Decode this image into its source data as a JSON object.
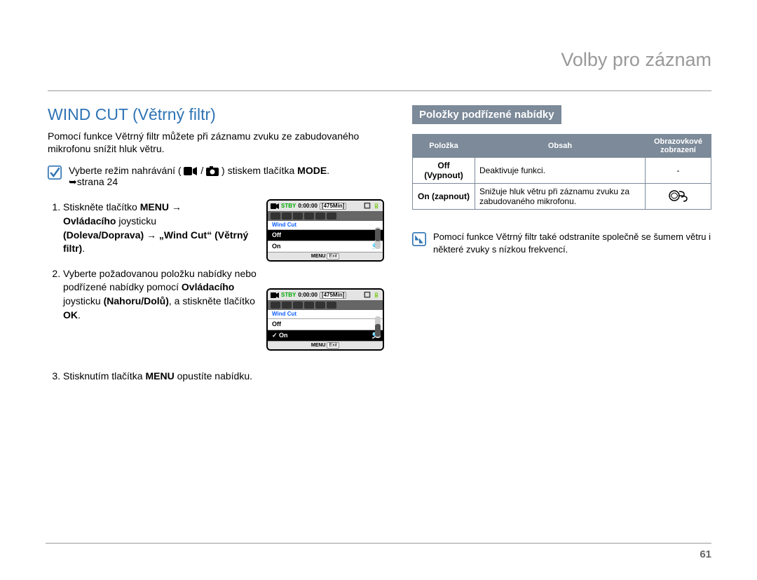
{
  "header": {
    "section": "Volby pro záznam"
  },
  "left": {
    "heading": "WIND CUT (Větrný filtr)",
    "intro": "Pomocí funkce Větrný filtr můžete při záznamu zvuku ze zabudovaného mikrofonu snížit hluk větru.",
    "modeLine": {
      "before": "Vyberte režim nahrávání (",
      "after": ") stiskem tlačítka ",
      "mode": "MODE",
      "page": "➥strana 24"
    },
    "step1": {
      "a": "Stiskněte tlačítko ",
      "menu": "MENU",
      "arrow": " → ",
      "b": "Ovládacího",
      "c": " joysticku ",
      "d": "(Doleva/Doprava) → „Wind Cut“ (Větrný filtr)"
    },
    "step2": {
      "a": "Vyberte požadovanou položku nabídky nebo podřízené nabídky pomocí ",
      "b": "Ovládacího",
      "c": " joysticku ",
      "d": "(Nahoru/Dolů)",
      "e": ", a stiskněte tlačítko ",
      "f": "OK"
    },
    "step3": {
      "a": "Stisknutím tlačítka ",
      "menu": "MENU",
      "b": " opustíte nabídku."
    },
    "thumb": {
      "stby": "STBY",
      "time": "0:00:00",
      "mins": "[475Min]",
      "label": "Wind Cut",
      "off": "Off",
      "on": "On",
      "footerMenu": "MENU",
      "footerExit": "Exit"
    }
  },
  "right": {
    "subhead": "Položky podřízené nabídky",
    "table": {
      "h1": "Položka",
      "h2": "Obsah",
      "h3": "Obrazovkové zobrazení",
      "r1a": "Off (Vypnout)",
      "r1b": "Deaktivuje funkci.",
      "r1c": "-",
      "r2a": "On (zapnout)",
      "r2b": "Snižuje hluk větru při záznamu zvuku za zabudovaného mikrofonu."
    },
    "note": "Pomocí funkce Větrný filtr také odstraníte společně se šumem větru i některé zvuky s nízkou frekvencí."
  },
  "pageNumber": "61"
}
